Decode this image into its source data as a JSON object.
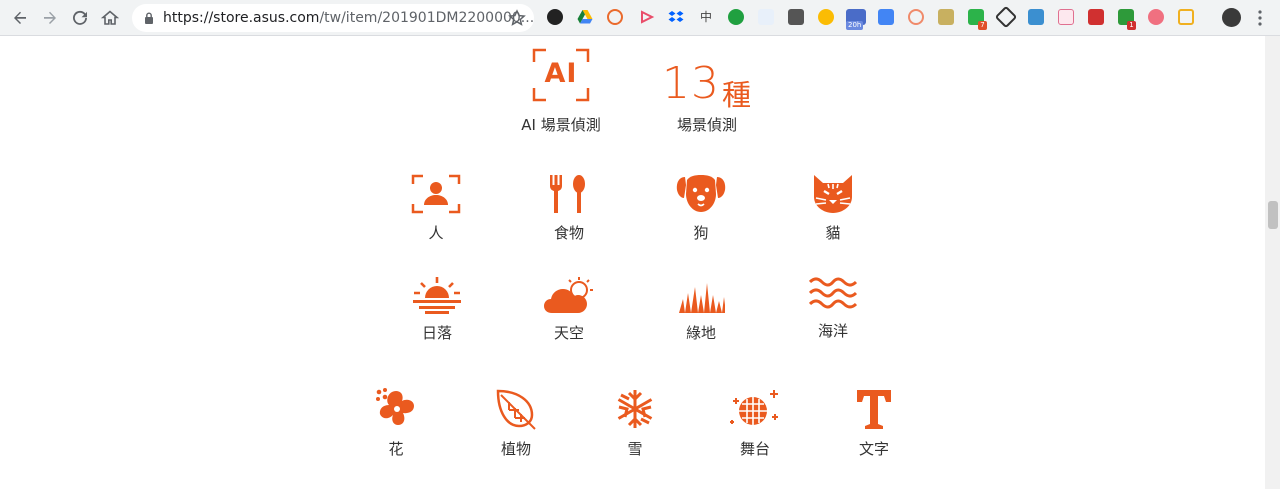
{
  "browser": {
    "url_host": "https://store.asus.com",
    "url_path": "/tw/item/201901DM2200000...",
    "extension_badges": [
      "7",
      "1"
    ],
    "ext_badge_extra": "20h"
  },
  "hero": {
    "ai_badge": "AI",
    "ai_label": "AI 場景偵測",
    "count_number": "13",
    "count_unit": "種",
    "count_label": "場景偵測"
  },
  "scenes_row1": [
    {
      "label": "人",
      "icon": "portrait-icon"
    },
    {
      "label": "食物",
      "icon": "fork-spoon-icon"
    },
    {
      "label": "狗",
      "icon": "dog-icon"
    },
    {
      "label": "貓",
      "icon": "cat-icon"
    }
  ],
  "scenes_row2": [
    {
      "label": "日落",
      "icon": "sunset-icon"
    },
    {
      "label": "天空",
      "icon": "sky-cloud-icon"
    },
    {
      "label": "綠地",
      "icon": "grass-icon"
    },
    {
      "label": "海洋",
      "icon": "waves-icon"
    }
  ],
  "scenes_row3": [
    {
      "label": "花",
      "icon": "flower-icon"
    },
    {
      "label": "植物",
      "icon": "leaf-icon"
    },
    {
      "label": "雪",
      "icon": "snowflake-icon"
    },
    {
      "label": "舞台",
      "icon": "stage-globe-icon"
    },
    {
      "label": "文字",
      "icon": "text-t-icon"
    }
  ],
  "colors": {
    "accent": "#ea5a1f",
    "text": "#333333"
  }
}
